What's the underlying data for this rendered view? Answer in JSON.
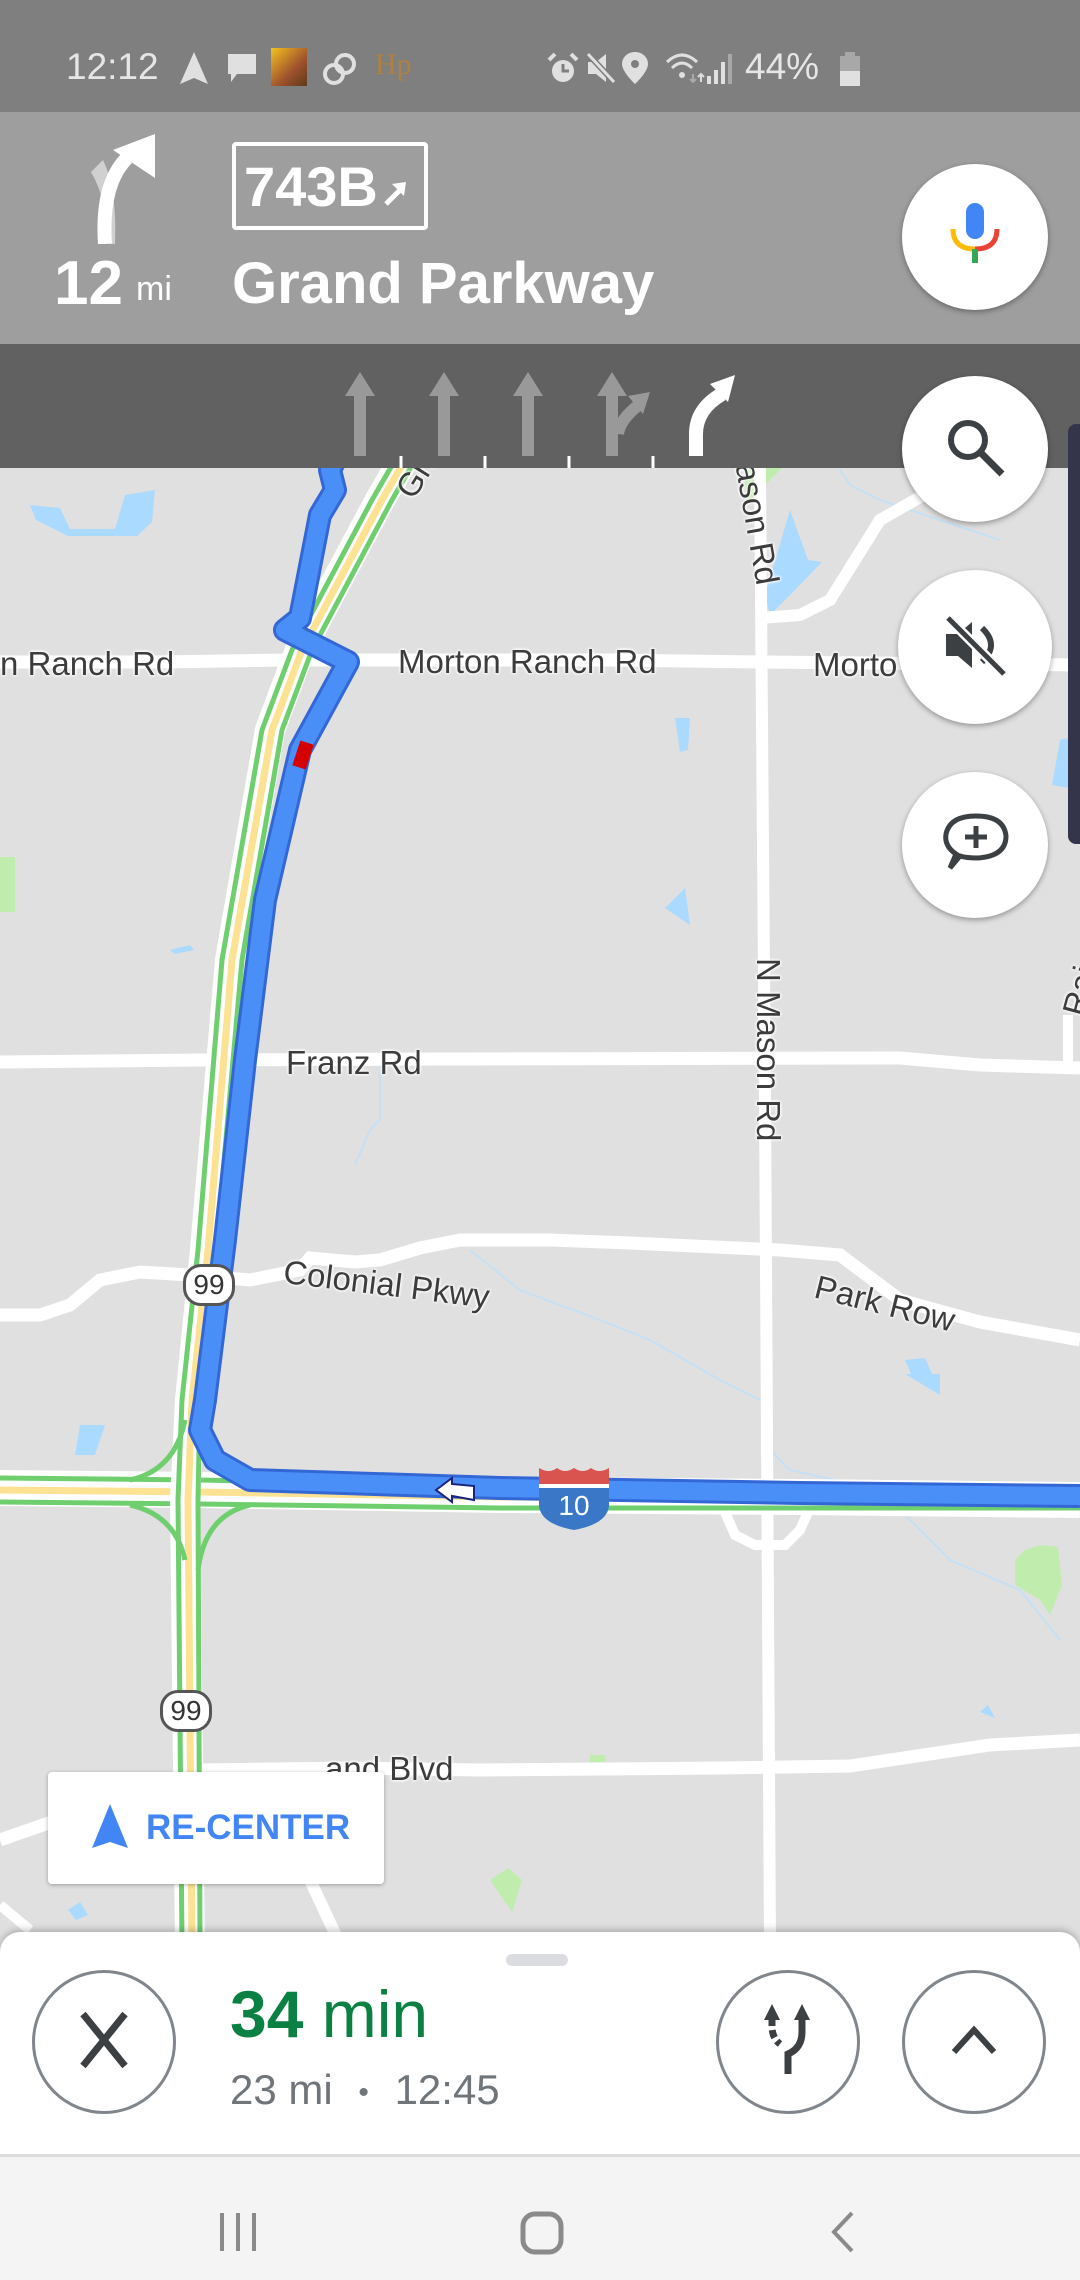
{
  "status_bar": {
    "time": "12:12",
    "battery_percent": "44%",
    "left_icons": [
      "navigation-arrow-icon",
      "message-icon",
      "game-app-icon",
      "link-icon",
      "hp-app-icon"
    ],
    "right_icons": [
      "alarm-icon",
      "mute-icon",
      "location-icon",
      "wifi-icon",
      "signal-icon",
      "battery-icon"
    ]
  },
  "navigation": {
    "maneuver": "keep-right",
    "distance_value": "12",
    "distance_unit": "mi",
    "exit_number": "743B",
    "street_name": "Grand Parkway",
    "lanes": [
      {
        "direction": "straight",
        "recommended": false
      },
      {
        "direction": "straight",
        "recommended": false
      },
      {
        "direction": "straight",
        "recommended": false
      },
      {
        "direction": "straight-or-right",
        "recommended": false
      },
      {
        "direction": "slight-right",
        "recommended": true
      }
    ]
  },
  "fabs": {
    "voice": "mic-icon",
    "search": "search-icon",
    "sound": "sound-muted-icon",
    "report": "add-report-icon"
  },
  "map": {
    "labels": {
      "morton_ranch_left": "n Ranch Rd",
      "morton_ranch_mid": "Morton Ranch Rd",
      "morton_ranch_right": "Morto",
      "grand": "Gran",
      "mason_top": "ason Rd",
      "n_mason": "N Mason Rd",
      "franz": "Franz Rd",
      "colonial": "Colonial Pkwy",
      "park_row": "Park Row",
      "blvd": "and Blvd",
      "rai": "Rai"
    },
    "shields": {
      "sh99_a": "99",
      "sh99_b": "99",
      "i10": "10"
    },
    "colors": {
      "route": "#4285f4",
      "traffic_green": "#6fcf6f",
      "traffic_yellow": "#fde293",
      "traffic_red": "#d50000",
      "water": "#aadaff",
      "park": "#c0ecae"
    }
  },
  "recenter": {
    "label": "RE-CENTER"
  },
  "trip": {
    "duration_value": "34",
    "duration_unit": "min",
    "distance": "23 mi",
    "separator": "•",
    "arrival_time": "12:45",
    "eta_color": "#0b8043"
  },
  "system_nav": {
    "recents": "recents-icon",
    "home": "home-icon",
    "back": "back-icon"
  }
}
